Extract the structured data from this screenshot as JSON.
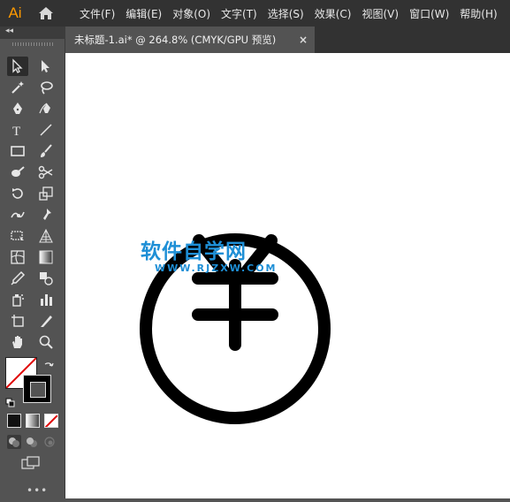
{
  "app": {
    "logo": "Ai"
  },
  "menu": [
    "文件(F)",
    "编辑(E)",
    "对象(O)",
    "文字(T)",
    "选择(S)",
    "效果(C)",
    "视图(V)",
    "窗口(W)",
    "帮助(H)"
  ],
  "document_tab": {
    "title": "未标题-1.ai* @ 264.8% (CMYK/GPU 预览)",
    "close": "×"
  },
  "toolbar": {
    "collapse": "◂◂",
    "more": "•••",
    "tools": [
      "selection-tool",
      "direct-selection-tool",
      "magic-wand-tool",
      "lasso-tool",
      "pen-tool",
      "curvature-tool",
      "type-tool",
      "line-segment-tool",
      "rectangle-tool",
      "paintbrush-tool",
      "shaper-tool",
      "scissors-tool",
      "rotate-tool",
      "scale-tool",
      "width-tool",
      "puppet-warp-tool",
      "free-transform-tool",
      "perspective-grid-tool",
      "mesh-tool",
      "gradient-tool",
      "eyedropper-tool",
      "blend-tool",
      "symbol-sprayer-tool",
      "column-graph-tool",
      "artboard-tool",
      "slice-tool",
      "hand-tool",
      "zoom-tool"
    ],
    "fill": "none",
    "stroke": "#000000"
  },
  "canvas": {
    "background": "#ffffff",
    "artwork": {
      "shape": "yen-coin-icon",
      "color": "#000000"
    },
    "watermark": {
      "text": "软件自学网",
      "subtext": "WWW.RJZXW.COM",
      "color": "#1e8fd6"
    }
  }
}
